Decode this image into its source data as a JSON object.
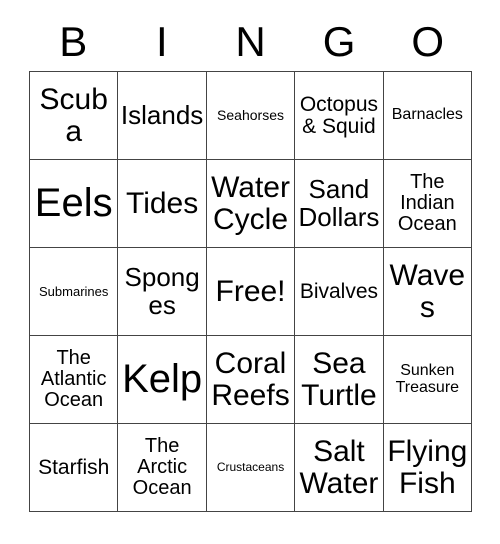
{
  "card": {
    "header_letters": [
      "B",
      "I",
      "N",
      "G",
      "O"
    ],
    "free_space_label": "Free!",
    "rows": [
      [
        {
          "label": "Scuba",
          "size": "xl"
        },
        {
          "label": "Islands",
          "size": "lg"
        },
        {
          "label": "Seahorses",
          "size": "xxs"
        },
        {
          "label": "Octopus & Squid",
          "size": "md"
        },
        {
          "label": "Barnacles",
          "size": "xs"
        }
      ],
      [
        {
          "label": "Eels",
          "size": "xxl"
        },
        {
          "label": "Tides",
          "size": "xl"
        },
        {
          "label": "Water Cycle",
          "size": "xl"
        },
        {
          "label": "Sand Dollars",
          "size": "lg"
        },
        {
          "label": "The Indian Ocean",
          "size": "sm"
        }
      ],
      [
        {
          "label": "Submarines",
          "size": "tiny"
        },
        {
          "label": "Sponges",
          "size": "lg"
        },
        {
          "label": "Free!",
          "size": "xl"
        },
        {
          "label": "Bivalves",
          "size": "md"
        },
        {
          "label": "Waves",
          "size": "xl"
        }
      ],
      [
        {
          "label": "The Atlantic Ocean",
          "size": "sm"
        },
        {
          "label": "Kelp",
          "size": "xxl"
        },
        {
          "label": "Coral Reefs",
          "size": "xl"
        },
        {
          "label": "Sea Turtle",
          "size": "xl"
        },
        {
          "label": "Sunken Treasure",
          "size": "xs"
        }
      ],
      [
        {
          "label": "Starfish",
          "size": "md"
        },
        {
          "label": "The Arctic Ocean",
          "size": "sm"
        },
        {
          "label": "Crustaceans",
          "size": "mini"
        },
        {
          "label": "Salt Water",
          "size": "xl"
        },
        {
          "label": "Flying Fish",
          "size": "xl"
        }
      ]
    ]
  }
}
